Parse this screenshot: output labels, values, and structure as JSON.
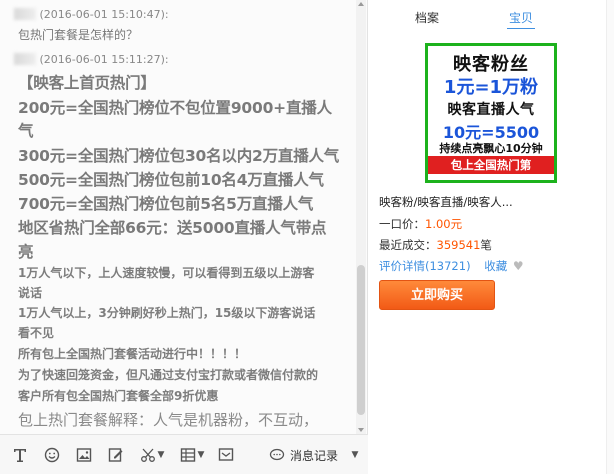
{
  "chat": {
    "messages": [
      {
        "timestamp": "(2016-06-01 15:10:47):",
        "lines": [
          "包热门套餐是怎样的？"
        ]
      },
      {
        "timestamp": "(2016-06-01 15:11:27):",
        "lines": [
          "【映客上首页热门】",
          "200元=全国热门榜位不包位置9000+直播人",
          "气",
          "300元=全国热门榜位包30名以内2万直播人气",
          "500元=全国热门榜位包前10名4万直播人气",
          "700元=全国热门榜位包前5名5万直播人气",
          "地区省热门全部66元：送5000直播人气带点",
          "亮",
          "1万人气以下，上人速度较慢，可以看得到五级以上游客",
          "说话",
          "1万人气以上，3分钟刷好秒上热门，15级以下游客说话",
          "看不见",
          "所有包上全国热门套餐活动进行中！！！！",
          "为了快速回笼资金，但凡通过支付宝打款或者微信付款的",
          "客户所有包全国热门套餐全部9折优惠",
          "包上热门套餐解释：人气是机器粉，不互动，"
        ]
      }
    ]
  },
  "toolbar": {
    "history_label": "消息记录"
  },
  "right": {
    "tabs": [
      "档案",
      "宝贝"
    ],
    "active_tab": "宝贝",
    "product": {
      "image_lines": [
        "映客粉丝",
        "1元=1万粉",
        "映客直播人气",
        "10元=5500",
        "持续点亮飘心10分钟",
        "包上全国热门第"
      ],
      "title": "映客粉/映客直播/映客人...",
      "price_label": "一口价：",
      "price": "1.00元",
      "sold_label": "最近成交：",
      "sold_count": "359541",
      "sold_unit": "笔",
      "reviews_link": "评价详情(13721)",
      "favorite_label": "收藏",
      "buy_button": "立即购买"
    }
  },
  "colors": {
    "accent_blue": "#3f8fe0",
    "price_orange": "#ff5500",
    "buy_orange": "#f25a16",
    "image_green": "#1db21d",
    "image_red": "#e02020"
  }
}
